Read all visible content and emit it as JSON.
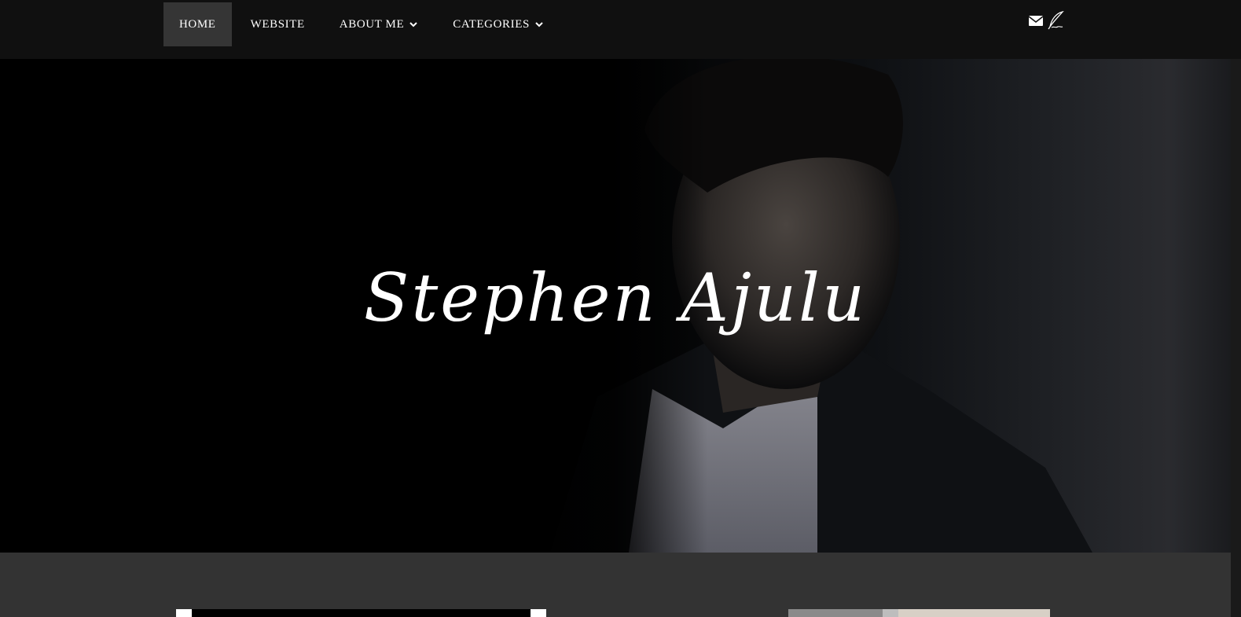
{
  "nav": {
    "items": [
      {
        "label": "HOME",
        "active": true,
        "dropdown": false
      },
      {
        "label": "WEBSITE",
        "active": false,
        "dropdown": false
      },
      {
        "label": "ABOUT ME",
        "active": false,
        "dropdown": true
      },
      {
        "label": "CATEGORIES",
        "active": false,
        "dropdown": true
      }
    ],
    "icons": [
      "envelope-icon",
      "quill-pen-icon"
    ]
  },
  "hero": {
    "title": "Stephen Ajulu"
  },
  "colors": {
    "navbar_bg": "#101010",
    "nav_active_bg": "#353535",
    "page_bg": "#333333",
    "hero_text": "#ffffff"
  }
}
